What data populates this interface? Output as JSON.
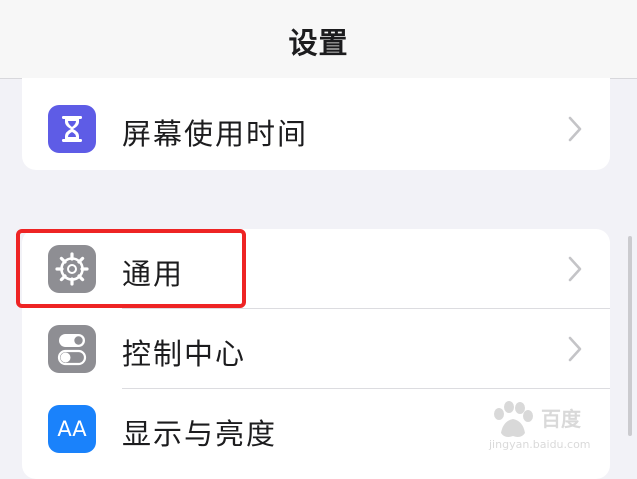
{
  "nav": {
    "title": "设置"
  },
  "settings_groups": [
    {
      "items": [
        {
          "label": "屏幕使用时间",
          "icon": "hourglass-icon",
          "icon_color": "#5e5ce6"
        }
      ]
    },
    {
      "items": [
        {
          "label": "通用",
          "icon": "gear-icon",
          "icon_color": "#8e8e93",
          "highlighted": true
        },
        {
          "label": "控制中心",
          "icon": "toggle-switches-icon",
          "icon_color": "#8e8e93"
        },
        {
          "label": "显示与亮度",
          "icon": "aa-text-icon",
          "icon_color": "#1a82fb",
          "icon_text": "AA"
        }
      ]
    }
  ],
  "highlight_color": "#ee2424",
  "watermark": {
    "main": "百度",
    "sub": "jingyan.baidu.com"
  }
}
